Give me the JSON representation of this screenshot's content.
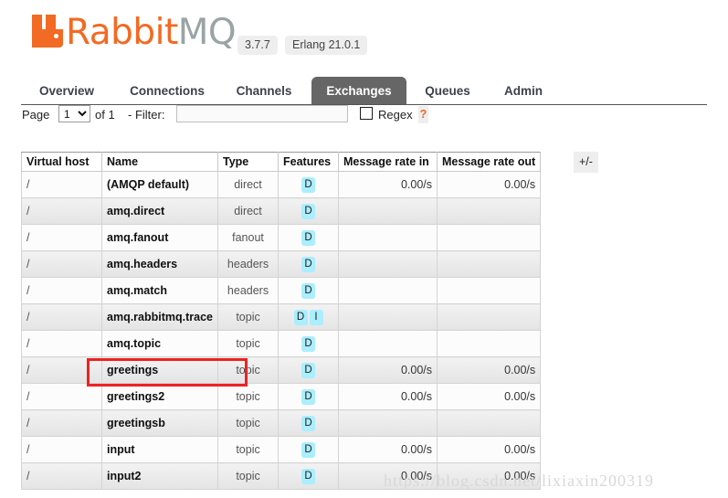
{
  "header": {
    "brand_rabbit": "Rabbit",
    "brand_mq": "MQ",
    "trademark": "™",
    "version": "3.7.7",
    "erlang_version": "Erlang 21.0.1",
    "logo_color": "#f26a23",
    "brand_mq_color": "#9aa4a4"
  },
  "nav": {
    "tabs": [
      {
        "label": "Overview",
        "active": false
      },
      {
        "label": "Connections",
        "active": false
      },
      {
        "label": "Channels",
        "active": false
      },
      {
        "label": "Exchanges",
        "active": true
      },
      {
        "label": "Queues",
        "active": false
      },
      {
        "label": "Admin",
        "active": false
      }
    ],
    "active_tab_bg": "#666666"
  },
  "filter_bar": {
    "page_label": "Page",
    "page_value": "1",
    "page_options": [
      "1"
    ],
    "of_label": "of 1",
    "filter_label": "- Filter:",
    "filter_value": "",
    "filter_placeholder": "",
    "regex_label": "Regex",
    "regex_checked": false,
    "help_label": "?"
  },
  "table": {
    "columns": [
      "Virtual host",
      "Name",
      "Type",
      "Features",
      "Message rate in",
      "Message rate out"
    ],
    "toggle_columns_label": "+/-",
    "rows": [
      {
        "vhost": "/",
        "name": "(AMQP default)",
        "type": "direct",
        "features": [
          "D"
        ],
        "rate_in": "0.00/s",
        "rate_out": "0.00/s"
      },
      {
        "vhost": "/",
        "name": "amq.direct",
        "type": "direct",
        "features": [
          "D"
        ],
        "rate_in": "",
        "rate_out": ""
      },
      {
        "vhost": "/",
        "name": "amq.fanout",
        "type": "fanout",
        "features": [
          "D"
        ],
        "rate_in": "",
        "rate_out": ""
      },
      {
        "vhost": "/",
        "name": "amq.headers",
        "type": "headers",
        "features": [
          "D"
        ],
        "rate_in": "",
        "rate_out": ""
      },
      {
        "vhost": "/",
        "name": "amq.match",
        "type": "headers",
        "features": [
          "D"
        ],
        "rate_in": "",
        "rate_out": ""
      },
      {
        "vhost": "/",
        "name": "amq.rabbitmq.trace",
        "type": "topic",
        "features": [
          "D",
          "I"
        ],
        "rate_in": "",
        "rate_out": ""
      },
      {
        "vhost": "/",
        "name": "amq.topic",
        "type": "topic",
        "features": [
          "D"
        ],
        "rate_in": "",
        "rate_out": ""
      },
      {
        "vhost": "/",
        "name": "greetings",
        "type": "topic",
        "features": [
          "D"
        ],
        "rate_in": "0.00/s",
        "rate_out": "0.00/s"
      },
      {
        "vhost": "/",
        "name": "greetings2",
        "type": "topic",
        "features": [
          "D"
        ],
        "rate_in": "0.00/s",
        "rate_out": "0.00/s"
      },
      {
        "vhost": "/",
        "name": "greetingsb",
        "type": "topic",
        "features": [
          "D"
        ],
        "rate_in": "",
        "rate_out": ""
      },
      {
        "vhost": "/",
        "name": "input",
        "type": "topic",
        "features": [
          "D"
        ],
        "rate_in": "0.00/s",
        "rate_out": "0.00/s"
      },
      {
        "vhost": "/",
        "name": "input2",
        "type": "topic",
        "features": [
          "D"
        ],
        "rate_in": "0.00/s",
        "rate_out": "0.00/s"
      }
    ],
    "feature_badge_color": "#aaeeff"
  },
  "annotation": {
    "highlight_row_name": "greetings",
    "color": "#ee2222"
  },
  "watermark": {
    "text": "https://blog.csdn.net/lixiaxin200319"
  }
}
